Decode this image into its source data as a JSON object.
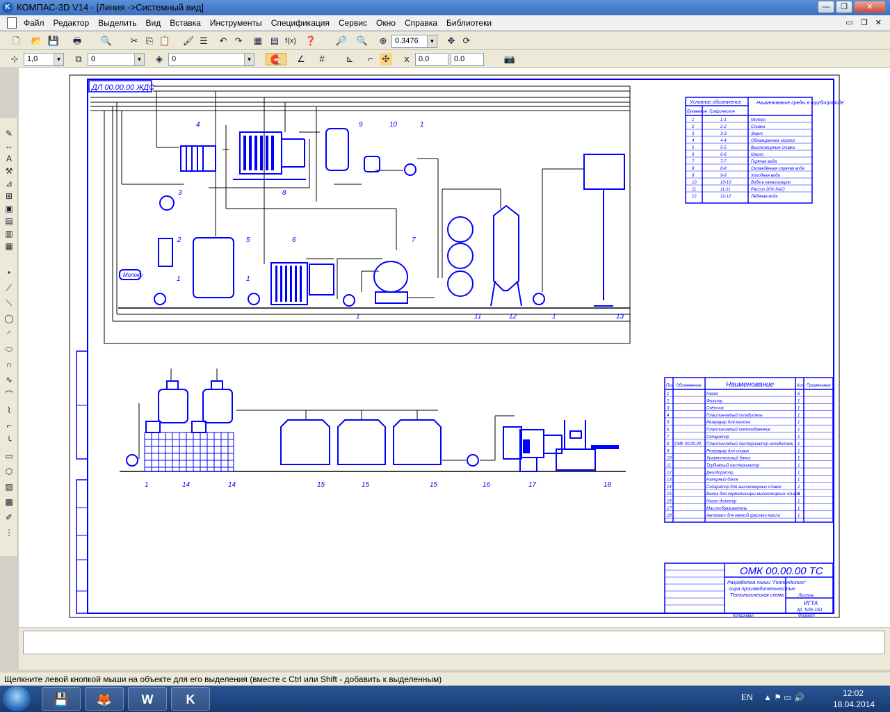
{
  "window": {
    "title": "КОМПАС-3D V14 - [Линия ->Системный вид]",
    "app_icon": "kompas-icon",
    "buttons": [
      "minimize",
      "restore",
      "close"
    ]
  },
  "menu": {
    "items": [
      "Файл",
      "Редактор",
      "Выделить",
      "Вид",
      "Вставка",
      "Инструменты",
      "Спецификация",
      "Сервис",
      "Окно",
      "Справка",
      "Библиотеки"
    ]
  },
  "toolbar1": {
    "zoom_value": "0.3476",
    "fx_label": "f(x)"
  },
  "toolbar2": {
    "scale_value": "1,0",
    "state_value": "0",
    "layer_value": "0",
    "coord_x": "0.0",
    "coord_y": "0.0"
  },
  "drawing": {
    "stamp": "ДЛ 00.00.00 ЖДС",
    "main_code": "ОМК 00.00.00 ТС",
    "title_lines": [
      "Разработка линии \"Голландского\"",
      "сыра производительностью",
      "Технологическая схема"
    ],
    "org": "ИГТА",
    "group": "гр. 526-161",
    "sheet_label": "Листов",
    "format_label": "Формат",
    "copy_label": "Копировал",
    "legend_header_1": "Условное обозначение",
    "legend_header_2": "Наименование среды в трубопроводе",
    "legend_sub_1": "Буквенное",
    "legend_sub_2": "Графическое",
    "legend": [
      {
        "n": "1",
        "g": "1-1",
        "name": "Молоко"
      },
      {
        "n": "2",
        "g": "2-2",
        "name": "Сливки"
      },
      {
        "n": "3",
        "g": "3-3",
        "name": "Зерно"
      },
      {
        "n": "4",
        "g": "4-4",
        "name": "Обезжиренное молоко"
      },
      {
        "n": "5",
        "g": "5-5",
        "name": "Высокожирные сливки"
      },
      {
        "n": "6",
        "g": "6-6",
        "name": "Масло"
      },
      {
        "n": "7",
        "g": "7-7",
        "name": "Горячая вода"
      },
      {
        "n": "8",
        "g": "8-8",
        "name": "Охлаждённая горячая вода"
      },
      {
        "n": "9",
        "g": "9-9",
        "name": "Холодная вода"
      },
      {
        "n": "10",
        "g": "10-10",
        "name": "Вода в канализацию"
      },
      {
        "n": "11",
        "g": "11-11",
        "name": "Рассол 20% NaCl"
      },
      {
        "n": "12",
        "g": "12-12",
        "name": "Ледяная вода"
      }
    ],
    "spec_headers": [
      "Поз",
      "Обозначение",
      "Наименование",
      "Кол",
      "Примечание"
    ],
    "spec": [
      {
        "n": "1",
        "code": "",
        "name": "Насос",
        "q": "6"
      },
      {
        "n": "2",
        "code": "",
        "name": "Фильтр",
        "q": "1"
      },
      {
        "n": "3",
        "code": "",
        "name": "Счётчик",
        "q": "1"
      },
      {
        "n": "4",
        "code": "",
        "name": "Пластинчатый охладитель",
        "q": "1"
      },
      {
        "n": "5",
        "code": "",
        "name": "Резервуар для молока",
        "q": "1"
      },
      {
        "n": "6",
        "code": "",
        "name": "Пластинчатый теплообменник",
        "q": "1"
      },
      {
        "n": "7",
        "code": "",
        "name": "Сепаратор",
        "q": "1"
      },
      {
        "n": "8",
        "code": "ОМК 00.00.00",
        "name": "Пластинчатый пастеризатор-охладитель",
        "q": "1"
      },
      {
        "n": "9",
        "code": "",
        "name": "Резервуар для сливок",
        "q": "1"
      },
      {
        "n": "10",
        "code": "",
        "name": "Уравнительный бачок",
        "q": "1"
      },
      {
        "n": "11",
        "code": "",
        "name": "Трубчатый пастеризатор",
        "q": "1"
      },
      {
        "n": "12",
        "code": "",
        "name": "Дезодоратор",
        "q": "1"
      },
      {
        "n": "13",
        "code": "",
        "name": "Напорный бачок",
        "q": "1"
      },
      {
        "n": "14",
        "code": "",
        "name": "Сепаратор для высокожирных сливок",
        "q": "2"
      },
      {
        "n": "15",
        "code": "",
        "name": "Ванна для нормализации высокожирных сливок",
        "q": "3"
      },
      {
        "n": "16",
        "code": "",
        "name": "Насос-дозатор",
        "q": "1"
      },
      {
        "n": "17",
        "code": "",
        "name": "Маслообразователь",
        "q": "1"
      },
      {
        "n": "18",
        "code": "",
        "name": "Автомат для мелкой фасовки масла",
        "q": "1"
      }
    ],
    "left_label_milk": "Молоко"
  },
  "status": {
    "hint": "Щелкните левой кнопкой мыши на объекте для его выделения (вместе с Ctrl или Shift - добавить к выделенным)"
  },
  "taskbar": {
    "lang": "EN",
    "time": "12:02",
    "date": "18.04.2014",
    "apps": [
      "save-app-icon",
      "firefox-icon",
      "word-icon",
      "kompas-taskbar-icon"
    ]
  }
}
